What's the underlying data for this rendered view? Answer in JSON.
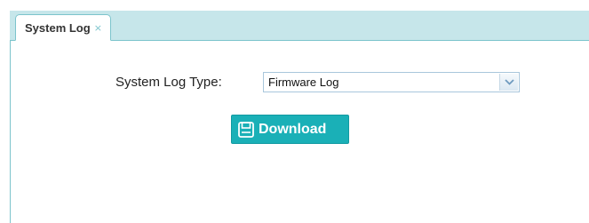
{
  "tabs": [
    {
      "label": "System Log",
      "close_glyph": "×",
      "active": true
    }
  ],
  "form": {
    "log_type_label": "System Log Type:",
    "log_type_selected": "Firmware Log",
    "download_label": "Download"
  },
  "icons": {
    "tab_close": "close-icon",
    "dropdown": "chevron-down-icon",
    "download": "save-icon"
  },
  "colors": {
    "accent": "#1ab0b7",
    "tabbar_bg": "#c6e6ea",
    "border": "#7cc4cc"
  }
}
